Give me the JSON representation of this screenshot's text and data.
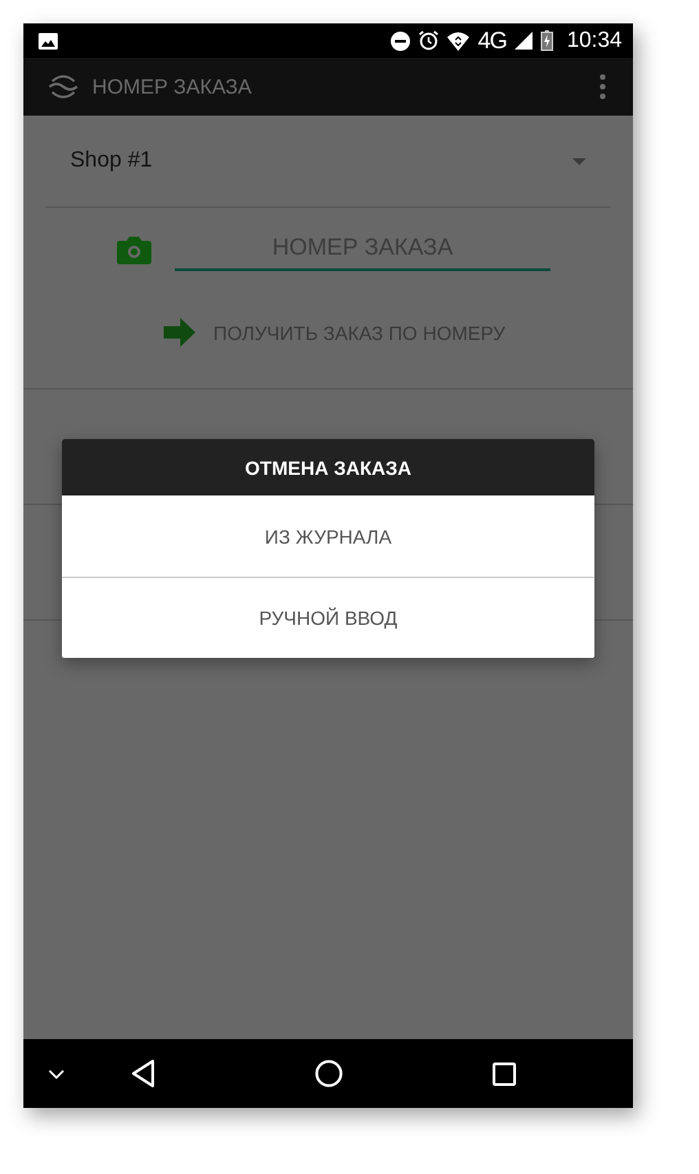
{
  "status_bar": {
    "network": "4G",
    "time": "10:34"
  },
  "app_bar": {
    "title": "НОМЕР ЗАКАЗА"
  },
  "shop_spinner": {
    "value": "Shop #1"
  },
  "order_field": {
    "placeholder": "НОМЕР ЗАКАЗА",
    "focused": true
  },
  "get_order_button": {
    "label": "ПОЛУЧИТЬ ЗАКАЗ ПО НОМЕРУ"
  },
  "dialog": {
    "title": "ОТМЕНА ЗАКАЗА",
    "options": [
      {
        "label": "ИЗ ЖУРНАЛА"
      },
      {
        "label": "РУЧНОЙ ВВОД"
      }
    ]
  }
}
